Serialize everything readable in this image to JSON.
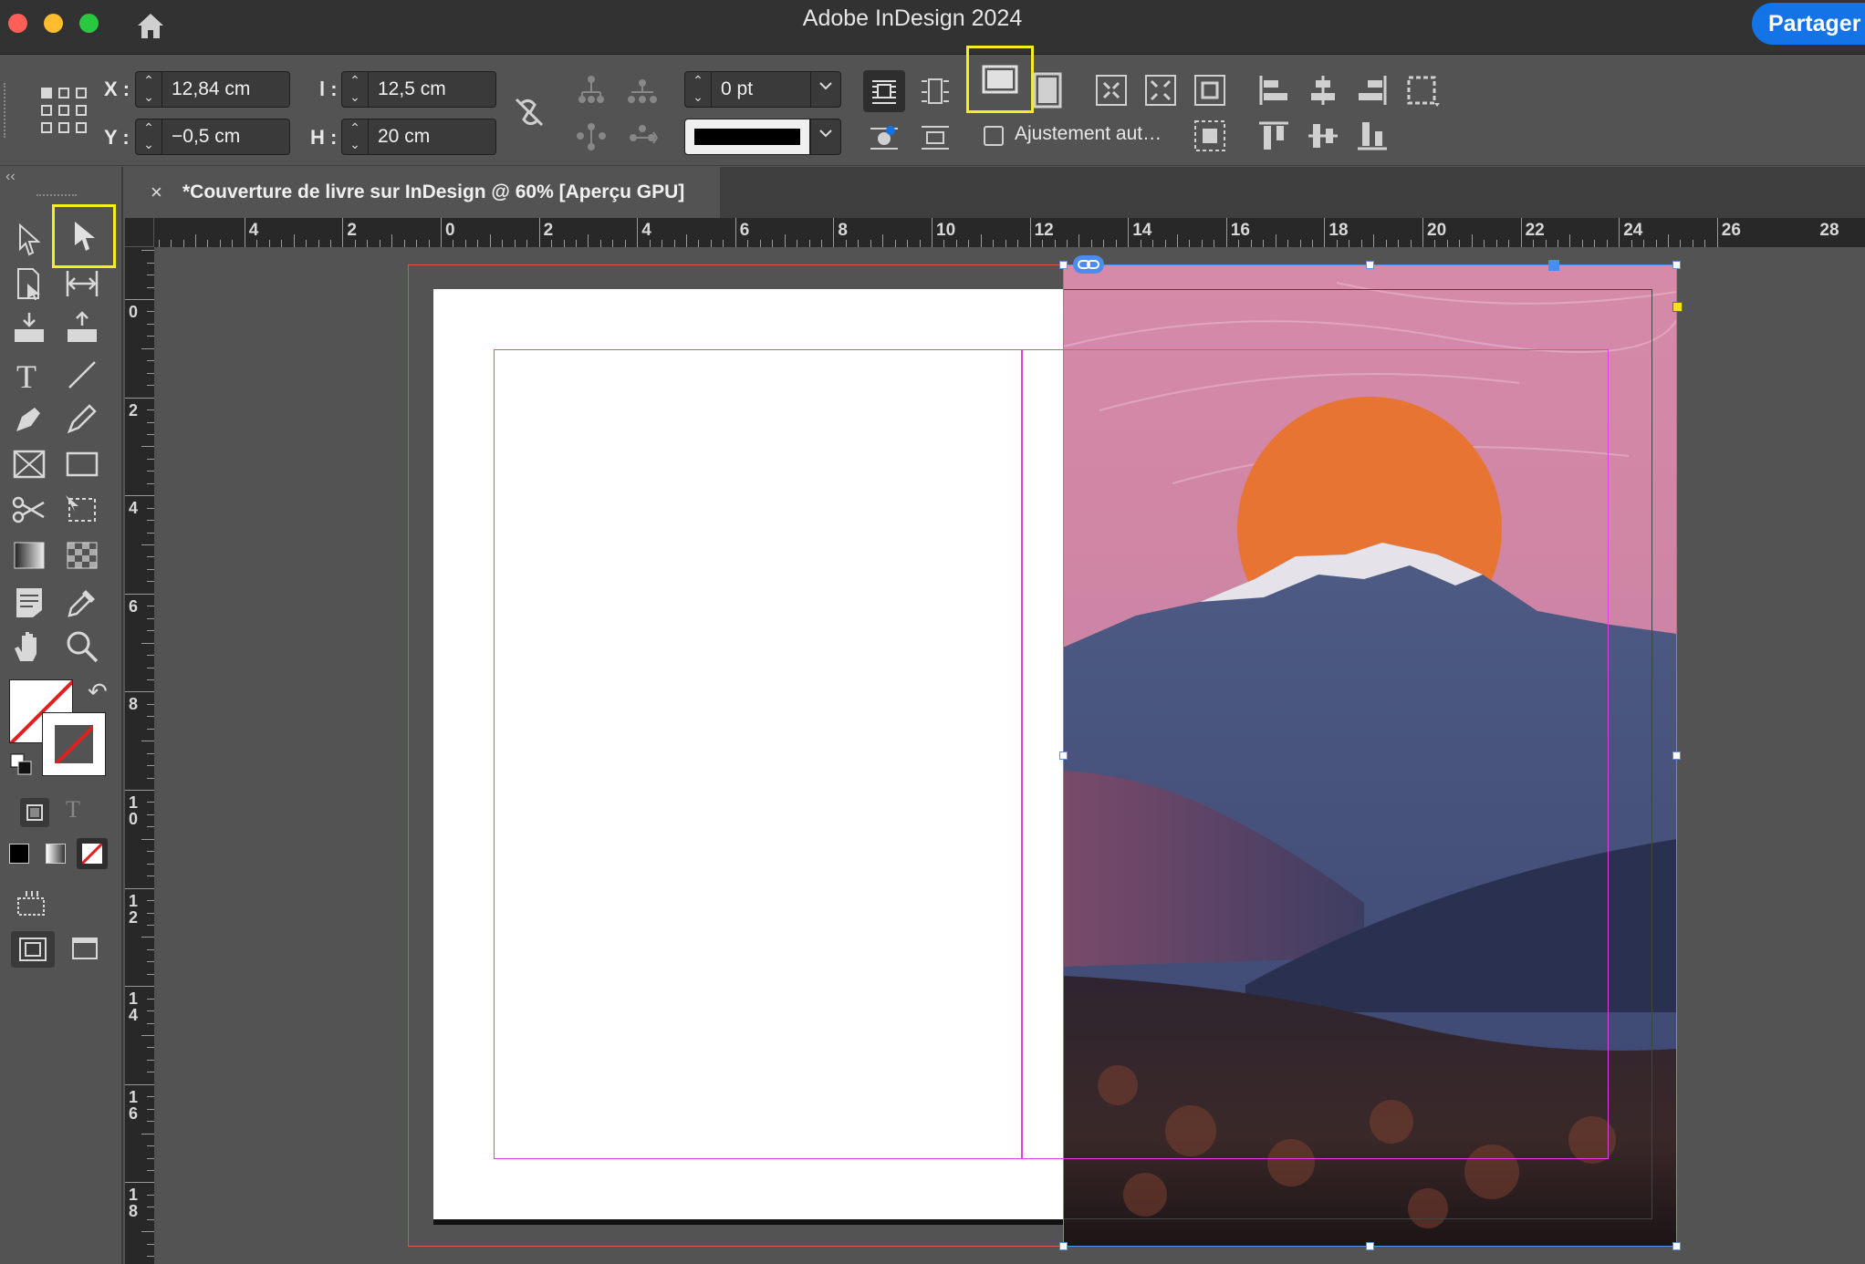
{
  "app": {
    "title": "Adobe InDesign 2024",
    "share_label": "Partager"
  },
  "window_controls": {
    "close_color": "#ff5f57",
    "minimize_color": "#febc2e",
    "zoom_color": "#28c840"
  },
  "control_bar": {
    "x_label": "X :",
    "x_value": "12,84 cm",
    "y_label": "Y :",
    "y_value": "−0,5 cm",
    "w_label": "l :",
    "w_value": "12,5 cm",
    "h_label": "H :",
    "h_value": "20 cm",
    "stroke_weight": "0 pt",
    "stroke_color": "#000000",
    "auto_fit_label": "Ajustement aut…",
    "auto_fit_checked": false
  },
  "document_tab": {
    "title": "*Couverture de livre sur InDesign @ 60% [Aperçu GPU]",
    "close_glyph": "×"
  },
  "toolbox": {
    "selected_tool": "direct-selection-tool",
    "fill_stroke_swap": "↶"
  },
  "rulers": {
    "horizontal_labels": [
      "4",
      "2",
      "0",
      "2",
      "4",
      "6",
      "8",
      "10",
      "12",
      "14",
      "16",
      "18",
      "20",
      "22",
      "24",
      "26",
      "28"
    ],
    "vertical_labels": [
      [
        "0"
      ],
      [
        "2"
      ],
      [
        "4"
      ],
      [
        "6"
      ],
      [
        "8"
      ],
      [
        "1",
        "0"
      ],
      [
        "1",
        "2"
      ],
      [
        "1",
        "4"
      ],
      [
        "1",
        "6"
      ],
      [
        "1",
        "8"
      ]
    ]
  },
  "colors": {
    "accent": "#1473e6",
    "highlight": "#f5ef1f",
    "margin_guide": "#e040e0",
    "bleed_guide": "#e0505a",
    "selection": "#5a8fe8",
    "sun": "#e87434",
    "sky": "#d98aa8"
  },
  "canvas": {
    "image_content": "mountain-sunset-photo"
  }
}
